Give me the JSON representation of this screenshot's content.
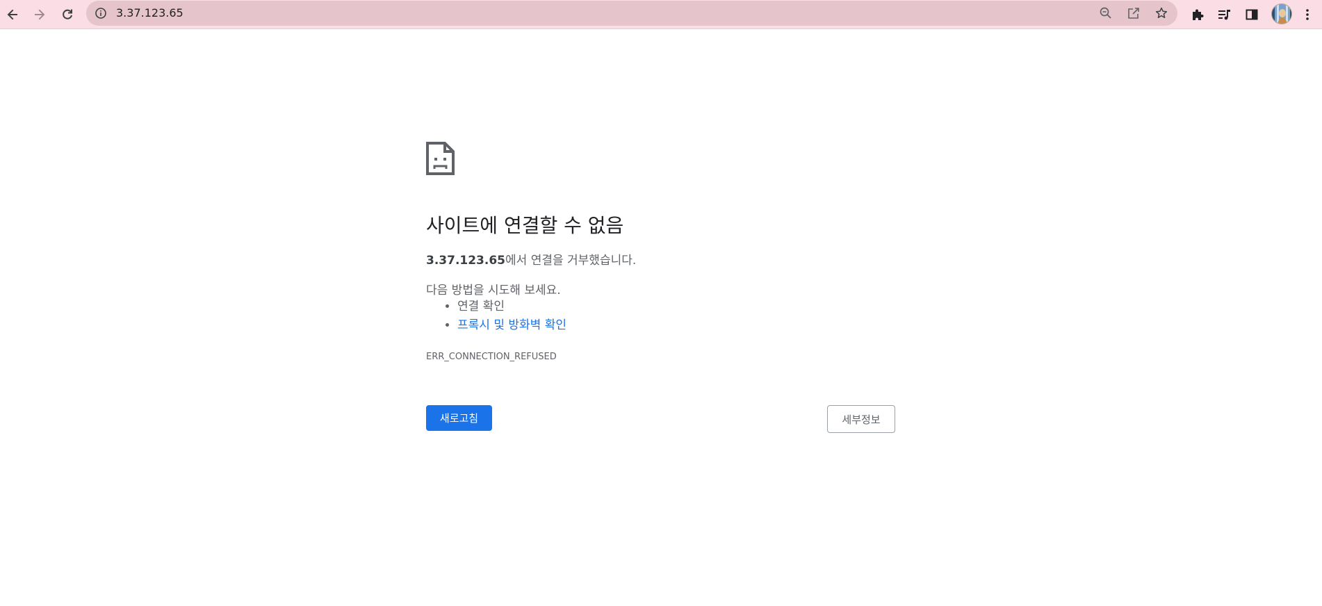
{
  "browser": {
    "url": "3.37.123.65",
    "theme_color": "#fbdde6",
    "omnibox_color": "#e5c4cb",
    "icons": {
      "back": "arrow-left-icon",
      "forward": "arrow-right-icon",
      "reload": "reload-icon",
      "site_info": "info-icon",
      "zoom": "zoom-out-icon",
      "share": "share-icon",
      "bookmark": "star-icon",
      "extensions": "puzzle-icon",
      "media": "media-control-icon",
      "side_panel": "side-panel-icon",
      "profile": "avatar",
      "menu": "kebab-menu-icon"
    }
  },
  "error_page": {
    "title": "사이트에 연결할 수 없음",
    "host": "3.37.123.65",
    "description_suffix": "에서 연결을 거부했습니다.",
    "try_heading": "다음 방법을 시도해 보세요.",
    "suggestions": [
      {
        "label": "연결 확인",
        "is_link": false
      },
      {
        "label": "프록시 및 방화벽 확인",
        "is_link": true
      }
    ],
    "error_code": "ERR_CONNECTION_REFUSED",
    "reload_label": "새로고침",
    "details_label": "세부정보",
    "accent_color": "#1a73e8",
    "icon": "sad-page-icon"
  }
}
